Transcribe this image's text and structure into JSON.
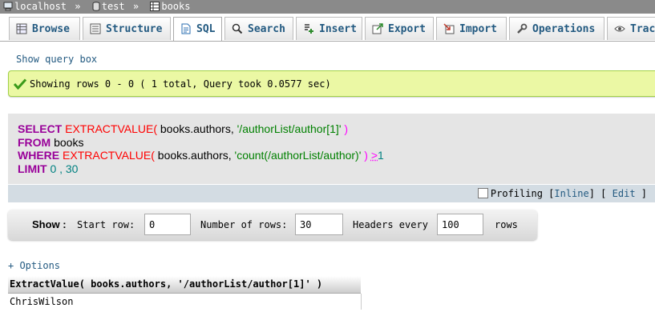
{
  "breadcrumb": {
    "server": "localhost",
    "database": "test",
    "table": "books",
    "separator": "»"
  },
  "tabs": [
    {
      "label": "Browse",
      "icon": "browse-icon",
      "active": false
    },
    {
      "label": "Structure",
      "icon": "structure-icon",
      "active": false
    },
    {
      "label": "SQL",
      "icon": "sql-icon",
      "active": true
    },
    {
      "label": "Search",
      "icon": "search-icon",
      "active": false
    },
    {
      "label": "Insert",
      "icon": "insert-icon",
      "active": false
    },
    {
      "label": "Export",
      "icon": "export-icon",
      "active": false
    },
    {
      "label": "Import",
      "icon": "import-icon",
      "active": false
    },
    {
      "label": "Operations",
      "icon": "operations-icon",
      "active": false
    },
    {
      "label": "Trac",
      "icon": "tracking-icon",
      "active": false
    }
  ],
  "show_query_box": "Show query box",
  "success_message": "Showing rows 0 - 0 ( 1 total, Query took 0.0577 sec)",
  "sql": {
    "line1": {
      "kw": "SELECT",
      "fn": "EXTRACTVALUE(",
      "arg1": " books.authors, ",
      "str": "'/authorList/author[1]'",
      "close": " )"
    },
    "line2": {
      "kw": "FROM",
      "rest": " books"
    },
    "line3": {
      "kw": "WHERE",
      "fn": "EXTRACTVALUE(",
      "arg1": " books.authors, ",
      "str": "'count(/authorList/author)'",
      "close": " )",
      "op": ">",
      "num": "1"
    },
    "line4": {
      "kw": "LIMIT",
      "num": "0 , 30"
    }
  },
  "profiling": {
    "label": "Profiling",
    "checked": false,
    "inline_label": "Inline",
    "edit_label": "Edit"
  },
  "navigation": {
    "show_label": "Show :",
    "start_row_label": "Start row:",
    "start_row_value": "0",
    "number_of_rows_label": "Number of rows:",
    "number_of_rows_value": "30",
    "headers_every_label": "Headers every",
    "headers_every_value": "100",
    "rows_label": "rows"
  },
  "options_link": "+ Options",
  "results": {
    "columns": [
      "ExtractValue( books.authors, '/authorList/author[1]' )"
    ],
    "rows": [
      [
        "ChrisWilson"
      ]
    ]
  },
  "colors": {
    "breadcrumb_bg": "#8a8a8a",
    "success_bg": "#ebf8a4",
    "success_border": "#a2d246",
    "link": "#235a81",
    "sql_keyword": "#990099",
    "sql_function": "#ff0000",
    "sql_string": "#008000",
    "sql_number": "#008080"
  }
}
